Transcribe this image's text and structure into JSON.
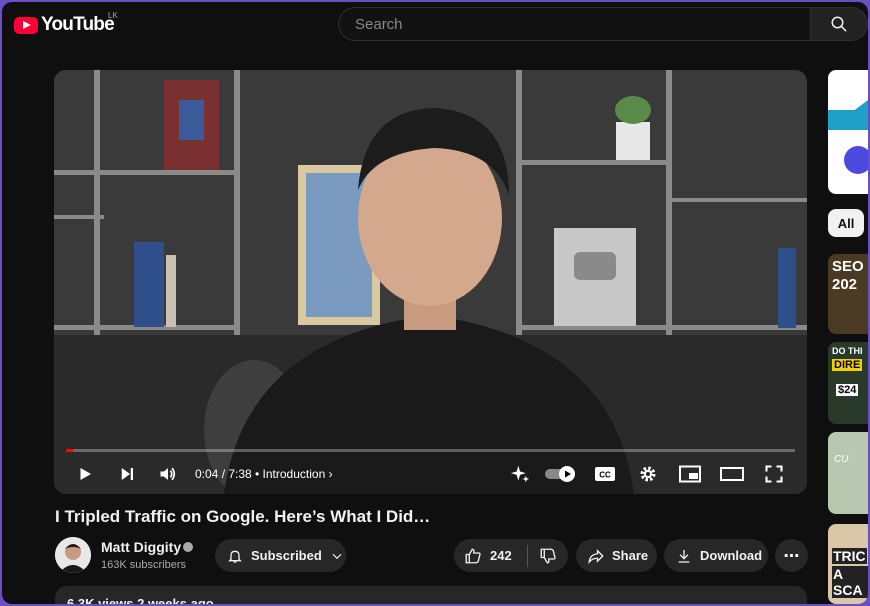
{
  "header": {
    "logo_text": "YouTube",
    "region": "LK",
    "search_placeholder": "Search"
  },
  "player": {
    "progress_fraction": 0.009,
    "time": "0:04 / 7:38",
    "separator": "•",
    "chapter": "Introduction",
    "chevron": "›"
  },
  "video": {
    "title": "I Tripled Traffic on Google. Here’s What I Did…",
    "views_line": "6.3K views  2 weeks ago"
  },
  "channel": {
    "name": "Matt Diggity",
    "subscribers": "163K subscribers"
  },
  "actions": {
    "subscribed_label": "Subscribed",
    "like_count": "242",
    "share_label": "Share",
    "download_label": "Download",
    "more_label": "⋯"
  },
  "sidebar": {
    "chip_all": "All",
    "thumb_texts": [
      "SEO",
      "202",
      "DO THI",
      "DIRE",
      "$24",
      "CU",
      "TRIC",
      "A SCA"
    ]
  },
  "colors": {
    "accent": "#ff0033",
    "page_bg": "#0f0f0f",
    "frame_border": "#6a4fc4"
  }
}
